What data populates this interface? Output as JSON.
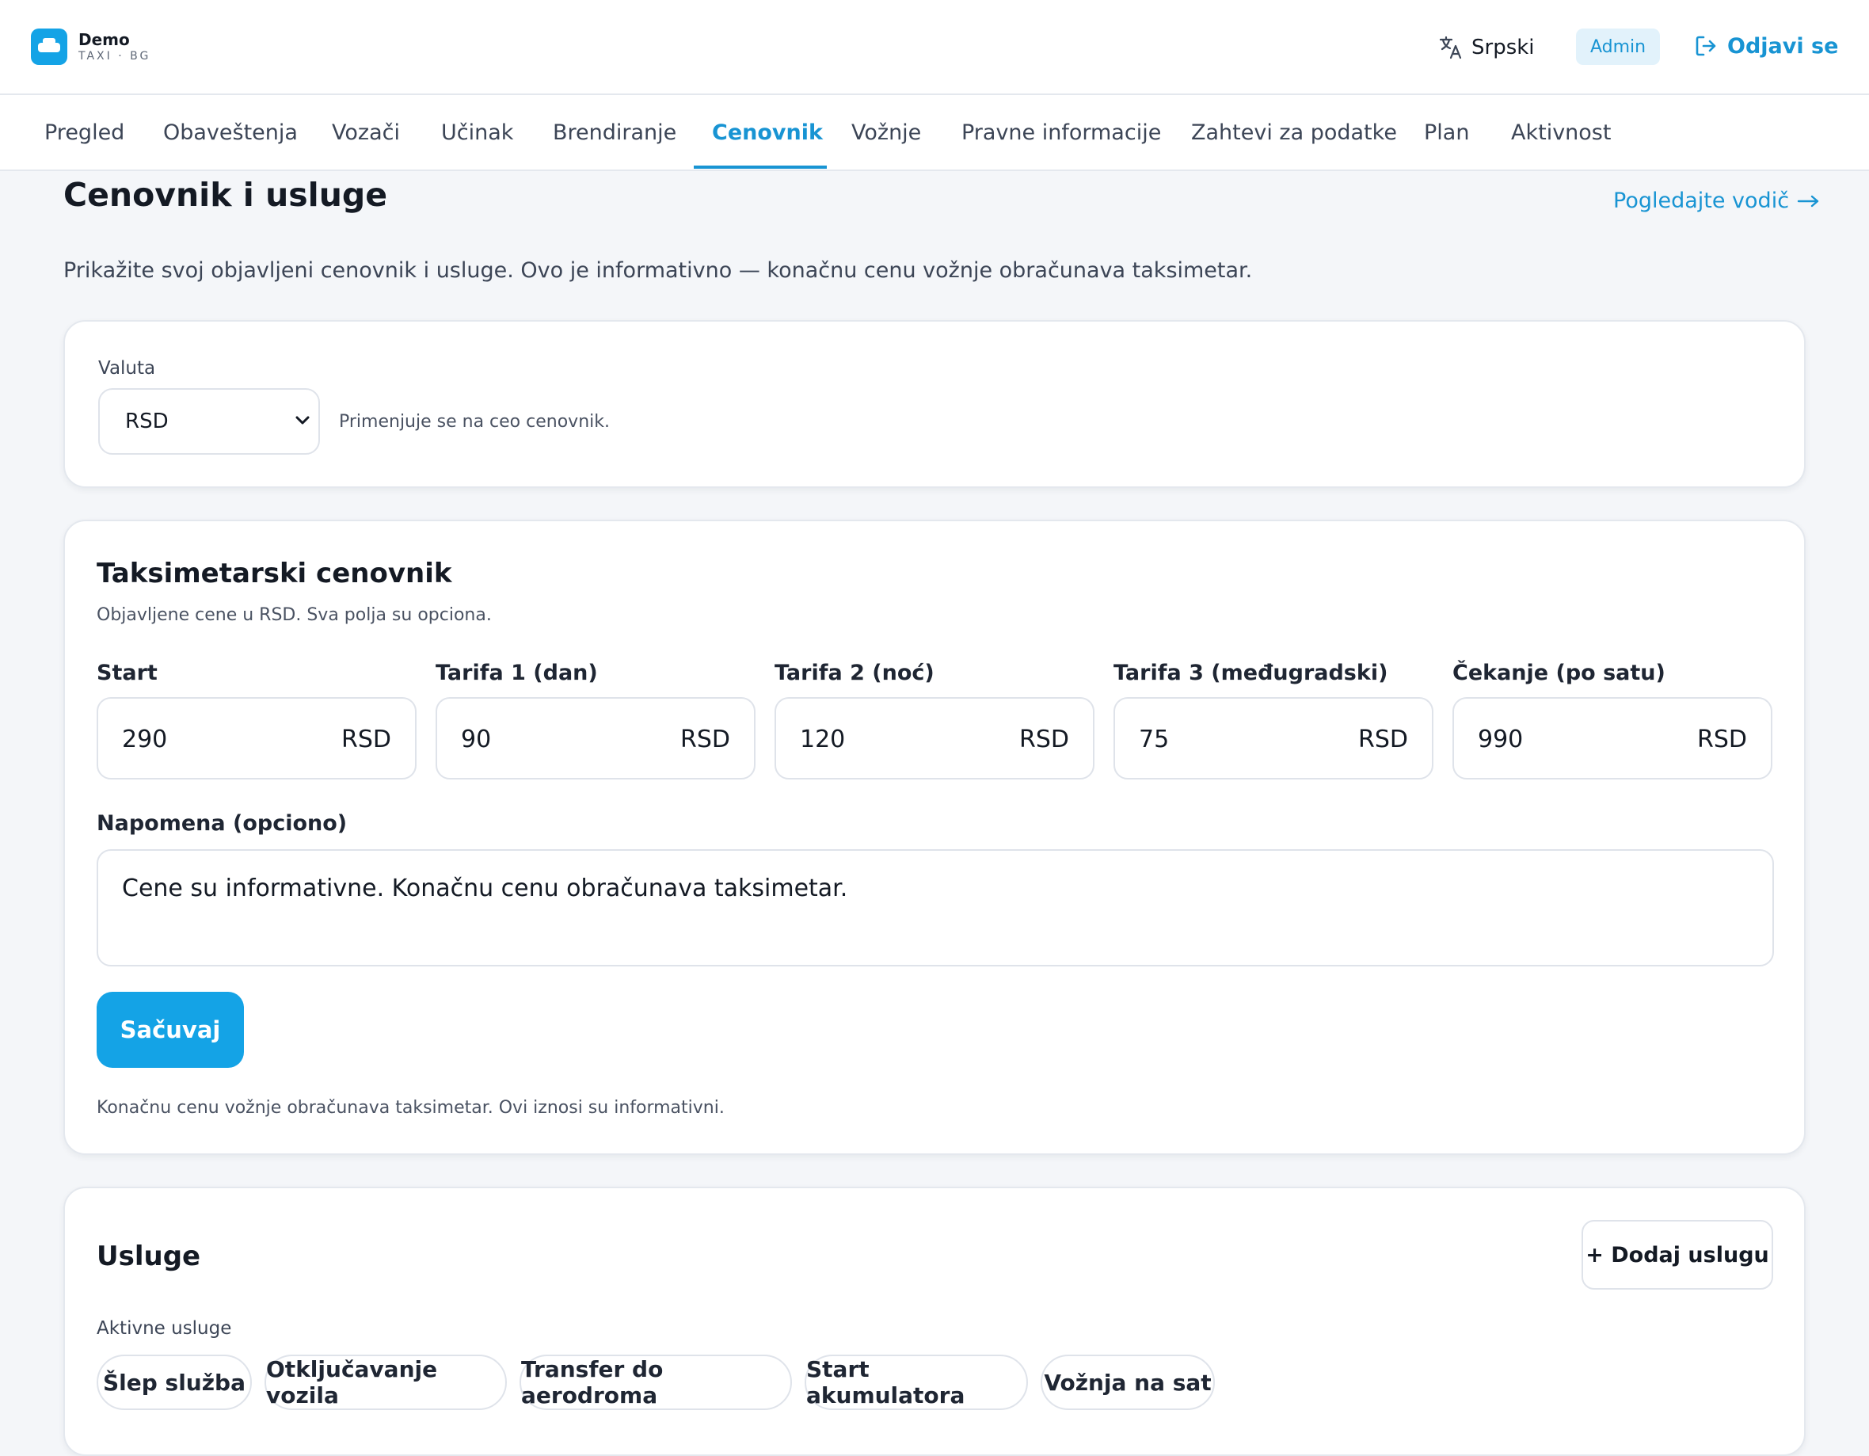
{
  "header": {
    "brand_name": "Demo",
    "brand_sub": "TAXI · BG",
    "language": "Srpski",
    "role_badge": "Admin",
    "logout_label": "Odjavi se"
  },
  "tabs": [
    {
      "label": "Pregled"
    },
    {
      "label": "Obaveštenja"
    },
    {
      "label": "Vozači"
    },
    {
      "label": "Učinak"
    },
    {
      "label": "Brendiranje"
    },
    {
      "label": "Cenovnik",
      "active": true
    },
    {
      "label": "Vožnje"
    },
    {
      "label": "Pravne informacije"
    },
    {
      "label": "Zahtevi za podatke"
    },
    {
      "label": "Plan"
    },
    {
      "label": "Aktivnost"
    }
  ],
  "page": {
    "title": "Cenovnik i usluge",
    "guide_link": "Pogledajte vodič",
    "description": "Prikažite svoj objavljeni cenovnik i usluge. Ovo je informativno — konačnu cenu vožnje obračunava taksimetar."
  },
  "currency": {
    "label": "Valuta",
    "selected": "RSD",
    "hint": "Primenjuje se na ceo cenovnik."
  },
  "tariffs": {
    "title": "Taksimetarski cenovnik",
    "subtitle": "Objavljene cene u RSD. Sva polja su opciona.",
    "fields": [
      {
        "label": "Start",
        "value": "290",
        "unit": "RSD"
      },
      {
        "label": "Tarifa 1 (dan)",
        "value": "90",
        "unit": "RSD"
      },
      {
        "label": "Tarifa 2 (noć)",
        "value": "120",
        "unit": "RSD"
      },
      {
        "label": "Tarifa 3 (međugradski)",
        "value": "75",
        "unit": "RSD"
      },
      {
        "label": "Čekanje (po satu)",
        "value": "990",
        "unit": "RSD"
      }
    ],
    "note_label": "Napomena (opciono)",
    "note_value": "Cene su informativne. Konačnu cenu obračunava taksimetar.",
    "save_label": "Sačuvaj",
    "footer_note": "Konačnu cenu vožnje obračunava taksimetar. Ovi iznosi su informativni."
  },
  "services": {
    "title": "Usluge",
    "add_label": "+ Dodaj uslugu",
    "active_label": "Aktivne usluge",
    "items": [
      {
        "label": "Šlep služba"
      },
      {
        "label": "Otključavanje vozila"
      },
      {
        "label": "Transfer do aerodroma"
      },
      {
        "label": "Start akumulatora"
      },
      {
        "label": "Vožnja na sat"
      }
    ]
  },
  "colors": {
    "accent": "#14a3e6",
    "accent_text": "#1894d3",
    "background": "#f4f6f9"
  }
}
